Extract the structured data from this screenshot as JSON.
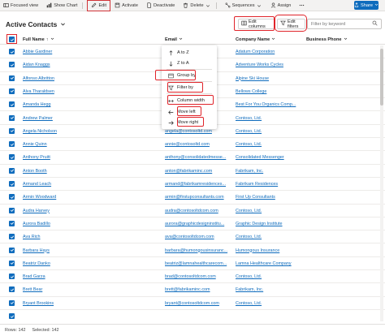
{
  "commandbar": {
    "items": [
      {
        "label": "Focused view",
        "icon": "focused-view-icon"
      },
      {
        "label": "Show Chart",
        "icon": "chart-icon"
      },
      {
        "label": "Edit",
        "icon": "edit-icon"
      },
      {
        "label": "Activate",
        "icon": "save-icon"
      },
      {
        "label": "Deactivate",
        "icon": "document-icon"
      },
      {
        "label": "Delete",
        "icon": "trash-icon"
      },
      {
        "label": "Sequences",
        "icon": "sequence-icon"
      },
      {
        "label": "Assign",
        "icon": "person-icon"
      }
    ],
    "share_label": "Share"
  },
  "header": {
    "title": "Active Contacts",
    "edit_columns_label": "Edit columns",
    "edit_filters_label": "Edit filters",
    "search_placeholder": "Filter by keyword"
  },
  "grid": {
    "columns": [
      "Full Name",
      "Email",
      "Company Name",
      "Business Phone"
    ],
    "rows": [
      {
        "name": "Abbie Gardiner",
        "email": "",
        "company": "Adatum Corporation"
      },
      {
        "name": "Aidan Knaggs",
        "email": "",
        "company": "Adventure Works Cycles"
      },
      {
        "name": "Alfonso Albritton",
        "email": "",
        "company": "Alpine Ski House"
      },
      {
        "name": "Alva Tharaldsen",
        "email": "",
        "company": "Bellows College"
      },
      {
        "name": "Amanda Hegg",
        "email": "",
        "company": "Best For You Organics Comp..."
      },
      {
        "name": "Andrew Palmer",
        "email": "",
        "company": "Contoso, Ltd."
      },
      {
        "name": "Angela Nicholson",
        "email": "angela@contosoltd.com",
        "company": "Contoso, Ltd."
      },
      {
        "name": "Annie Quinn",
        "email": "annie@contosoltd.com",
        "company": "Contoso, Ltd."
      },
      {
        "name": "Anthony Pruitt",
        "email": "anthony@consolidatedmesse...",
        "company": "Consolidated Messenger"
      },
      {
        "name": "Anton Booth",
        "email": "anton@fabrikaminc.com",
        "company": "Fabrikam, Inc."
      },
      {
        "name": "Armand Leach",
        "email": "armand@fabrikamresidences...",
        "company": "Fabrikam Residences"
      },
      {
        "name": "Armin Woodward",
        "email": "armin@firstupconsultants.com",
        "company": "First Up Consultants"
      },
      {
        "name": "Audra Harvey",
        "email": "audra@contosoltdcom.com",
        "company": "Contoso, Ltd."
      },
      {
        "name": "Aurora Badillo",
        "email": "aurora@graphicdesigninstitu...",
        "company": "Graphic Design Institute"
      },
      {
        "name": "Ava Rich",
        "email": "ava@contosoltdcom.com",
        "company": "Contoso, Ltd."
      },
      {
        "name": "Barbara Hays",
        "email": "barbara@humongousinsuranc...",
        "company": "Humongous Insurance"
      },
      {
        "name": "Beatriz Danko",
        "email": "beatriz@lamnahealthcarecom...",
        "company": "Lamna Healthcare Company"
      },
      {
        "name": "Brad Garza",
        "email": "brad@contosoltdcom.com",
        "company": "Contoso, Ltd."
      },
      {
        "name": "Brett Bear",
        "email": "brett@fabrikaminc.com",
        "company": "Fabrikam, Inc."
      },
      {
        "name": "Bryant Brookins",
        "email": "bryant@contosoltdcom.com",
        "company": "Contoso, Ltd."
      },
      {
        "name": "",
        "email": "",
        "company": ""
      }
    ]
  },
  "menu": {
    "items": [
      {
        "label": "A to Z",
        "icon": "sort-ascending-icon"
      },
      {
        "label": "Z to A",
        "icon": "sort-descending-icon"
      },
      {
        "label": "Group by",
        "icon": "group-icon"
      },
      {
        "label": "Filter by",
        "icon": "filter-icon"
      },
      {
        "label": "Column width",
        "icon": "column-width-icon"
      },
      {
        "label": "Move left",
        "icon": "arrow-left-icon"
      },
      {
        "label": "Move right",
        "icon": "arrow-right-icon"
      }
    ]
  },
  "footer": {
    "rows": "Rows: 142",
    "selected": "Selected: 142"
  },
  "colors": {
    "accent": "#0f6cbd",
    "highlight": "#e0242a"
  }
}
